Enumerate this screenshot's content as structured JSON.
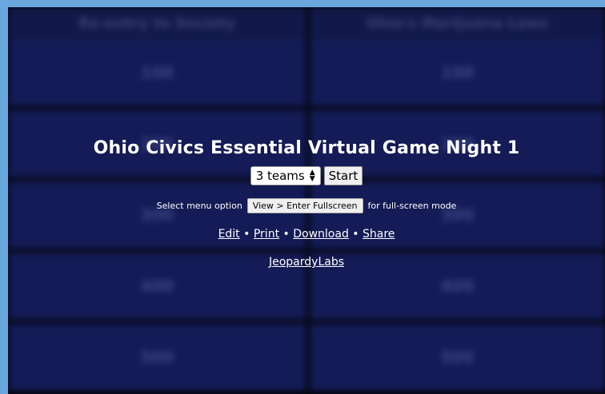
{
  "board": {
    "categories": [
      "Re-entry to Society",
      "Ohio's Marijuana Laws"
    ],
    "values": [
      "100",
      "200",
      "300",
      "400",
      "500"
    ]
  },
  "game": {
    "title": "Ohio Civics Essential Virtual Game Night 1",
    "teams_selected": "3 teams",
    "start_label": "Start"
  },
  "fullscreen": {
    "prefix": "Select menu option",
    "menu_path": "View > Enter Fullscreen",
    "suffix": "for full-screen mode"
  },
  "links": {
    "edit": "Edit",
    "print": "Print",
    "download": "Download",
    "share": "Share",
    "separator": "•"
  },
  "brand": "JeopardyLabs",
  "colors": {
    "page_border": "#6aa7dc",
    "cell": "#141b56",
    "text": "#ffffff"
  }
}
